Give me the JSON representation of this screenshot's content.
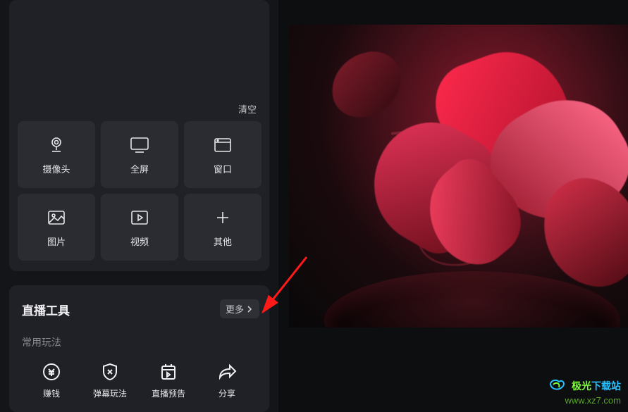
{
  "sources": {
    "clear_label": "清空",
    "tiles": [
      {
        "name": "camera",
        "label": "摄像头"
      },
      {
        "name": "fullscreen",
        "label": "全屏"
      },
      {
        "name": "window",
        "label": "窗口"
      },
      {
        "name": "image",
        "label": "图片"
      },
      {
        "name": "video",
        "label": "视频"
      },
      {
        "name": "other",
        "label": "其他"
      }
    ]
  },
  "tools_section": {
    "title": "直播工具",
    "more_label": "更多",
    "subsection_label": "常用玩法",
    "items": [
      {
        "name": "earn-money",
        "label": "赚钱"
      },
      {
        "name": "danmu-play",
        "label": "弹幕玩法"
      },
      {
        "name": "live-preview",
        "label": "直播预告"
      },
      {
        "name": "share",
        "label": "分享"
      }
    ]
  },
  "watermark": {
    "brand_prefix": "极光",
    "brand_suffix": "下载站",
    "url": "www.xz7.com"
  }
}
